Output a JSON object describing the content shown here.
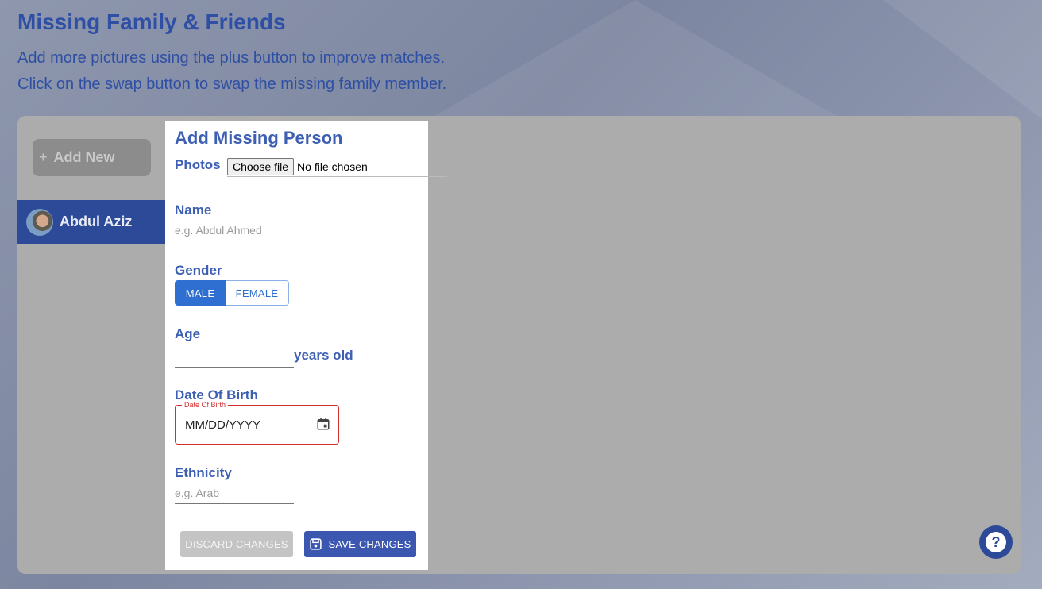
{
  "header": {
    "title": "Missing Family & Friends",
    "subtitle_1": "Add more pictures using the plus button to improve matches.",
    "subtitle_2": "Click on the swap button to swap the missing family member."
  },
  "sidebar": {
    "add_new_icon": "+",
    "add_new_label": "Add New",
    "members": [
      {
        "name": "Abdul Aziz",
        "avatar": "avatar-photo"
      }
    ]
  },
  "modal": {
    "title": "Add Missing Person",
    "photos_label": "Photos",
    "choose_file_label": "Choose file",
    "no_file_text": "No file chosen",
    "name_label": "Name",
    "name_placeholder": "e.g. Abdul Ahmed",
    "gender_label": "Gender",
    "gender_options": [
      "MALE",
      "FEMALE"
    ],
    "gender_selected": "MALE",
    "age_label": "Age",
    "age_value": "",
    "age_suffix": "years old",
    "dob_label": "Date Of Birth",
    "dob_field_legend": "Date Of Birth",
    "dob_placeholder": "MM/DD/YYYY",
    "ethnicity_label": "Ethnicity",
    "ethnicity_placeholder": "e.g. Arab",
    "discard_label": "DISCARD CHANGES",
    "save_label": "SAVE CHANGES"
  },
  "help": {
    "icon": "question-mark",
    "glyph": "?"
  },
  "colors": {
    "brand_blue": "#2e4fa3",
    "selected_blue": "#2f6fd1",
    "error_red": "#d32f2f",
    "panel_gray": "#acacac"
  }
}
